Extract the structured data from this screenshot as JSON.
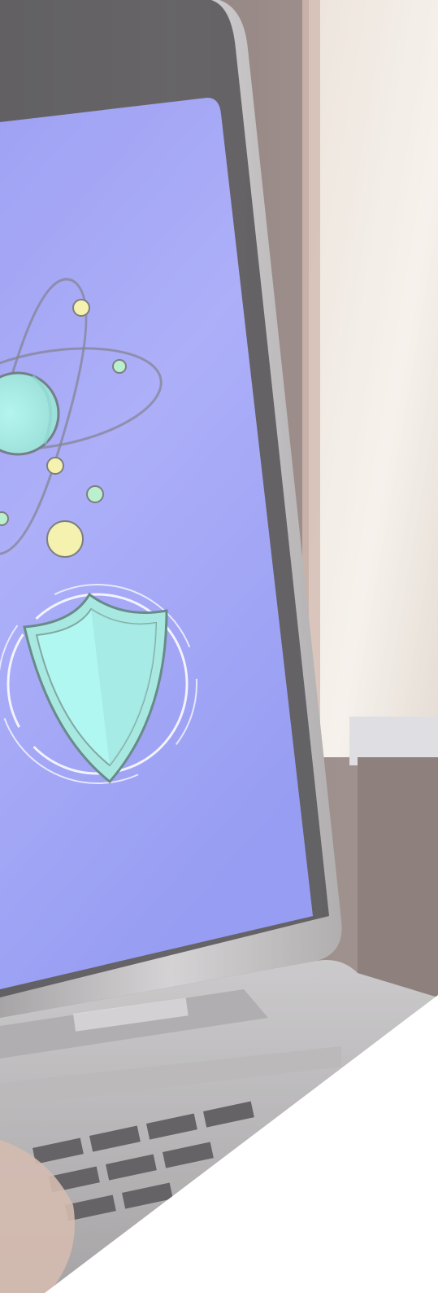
{
  "image": {
    "description_colors": {
      "screen": "#8a8ef5",
      "screen_dark": "#7478ee",
      "laptop_frame": "#b9b6b8",
      "background_wall": "#6e5c58",
      "window_light": "#efe7df",
      "atom_nucleus": "#8fe3dc",
      "atom_yellow": "#f3ef9a",
      "atom_green": "#a8ecc0",
      "shield": "#97ece0",
      "white_overlay": "#ffffff"
    },
    "icons": [
      "atom-icon",
      "shield-icon"
    ]
  }
}
